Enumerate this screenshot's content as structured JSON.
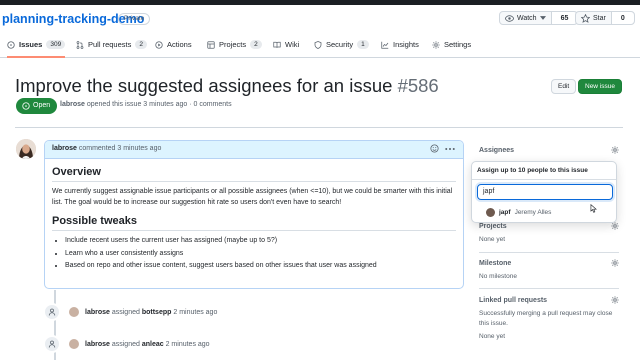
{
  "repo": {
    "name": "planning-tracking-demo",
    "visibility": "Private",
    "watch_label": "Watch",
    "watch_count": "65",
    "star_label": "Star",
    "star_count": "0"
  },
  "tabs": [
    {
      "label": "Issues",
      "count": "309",
      "icon": "issue-opened-icon",
      "active": true
    },
    {
      "label": "Pull requests",
      "count": "2",
      "icon": "git-pull-request-icon"
    },
    {
      "label": "Actions",
      "count": "",
      "icon": "play-icon"
    },
    {
      "label": "Projects",
      "count": "2",
      "icon": "table-icon"
    },
    {
      "label": "Wiki",
      "count": "",
      "icon": "book-icon"
    },
    {
      "label": "Security",
      "count": "1",
      "icon": "shield-icon"
    },
    {
      "label": "Insights",
      "count": "",
      "icon": "graph-icon"
    },
    {
      "label": "Settings",
      "count": "",
      "icon": "gear-icon"
    }
  ],
  "issue": {
    "title": "Improve the suggested assignees for an issue",
    "number": "#586",
    "state": "Open",
    "author": "labrose",
    "opened_text": "opened this issue 3 minutes ago · 0 comments",
    "edit_label": "Edit",
    "new_issue_label": "New issue"
  },
  "comment": {
    "author": "labrose",
    "time_text": "commented 3 minutes ago",
    "heading1": "Overview",
    "paragraph": "We currently suggest assignable issue participants or all possible assignees (when <=10), but we could be smarter with this initial list. The goal would be to increase our suggestion hit rate so users don't even have to search!",
    "heading2": "Possible tweaks",
    "bullets": [
      "Include recent users the current user has assigned (maybe up to 5?)",
      "Learn who a user consistently assigns",
      "Based on repo and other issue content, suggest users based on other issues that user was assigned"
    ]
  },
  "timeline": [
    {
      "actor": "labrose",
      "action": "assigned",
      "target": "bottsepp",
      "time": "2 minutes ago"
    },
    {
      "actor": "labrose",
      "action": "assigned",
      "target": "anleac",
      "time": "2 minutes ago"
    }
  ],
  "sidebar": {
    "assignees_title": "Assignees",
    "projects_title": "Projects",
    "projects_value": "None yet",
    "milestone_title": "Milestone",
    "milestone_value": "No milestone",
    "linked_title": "Linked pull requests",
    "linked_text": "Successfully merging a pull request may close this issue.",
    "linked_value": "None yet"
  },
  "assignee_popover": {
    "header": "Assign up to 10 people to this issue",
    "filter_value": "japf",
    "result_login": "japf",
    "result_name": "Jeremy Alles"
  },
  "colors": {
    "accent": "#0969da",
    "open_green": "#1f883d",
    "tab_underline": "#fd8c73"
  }
}
